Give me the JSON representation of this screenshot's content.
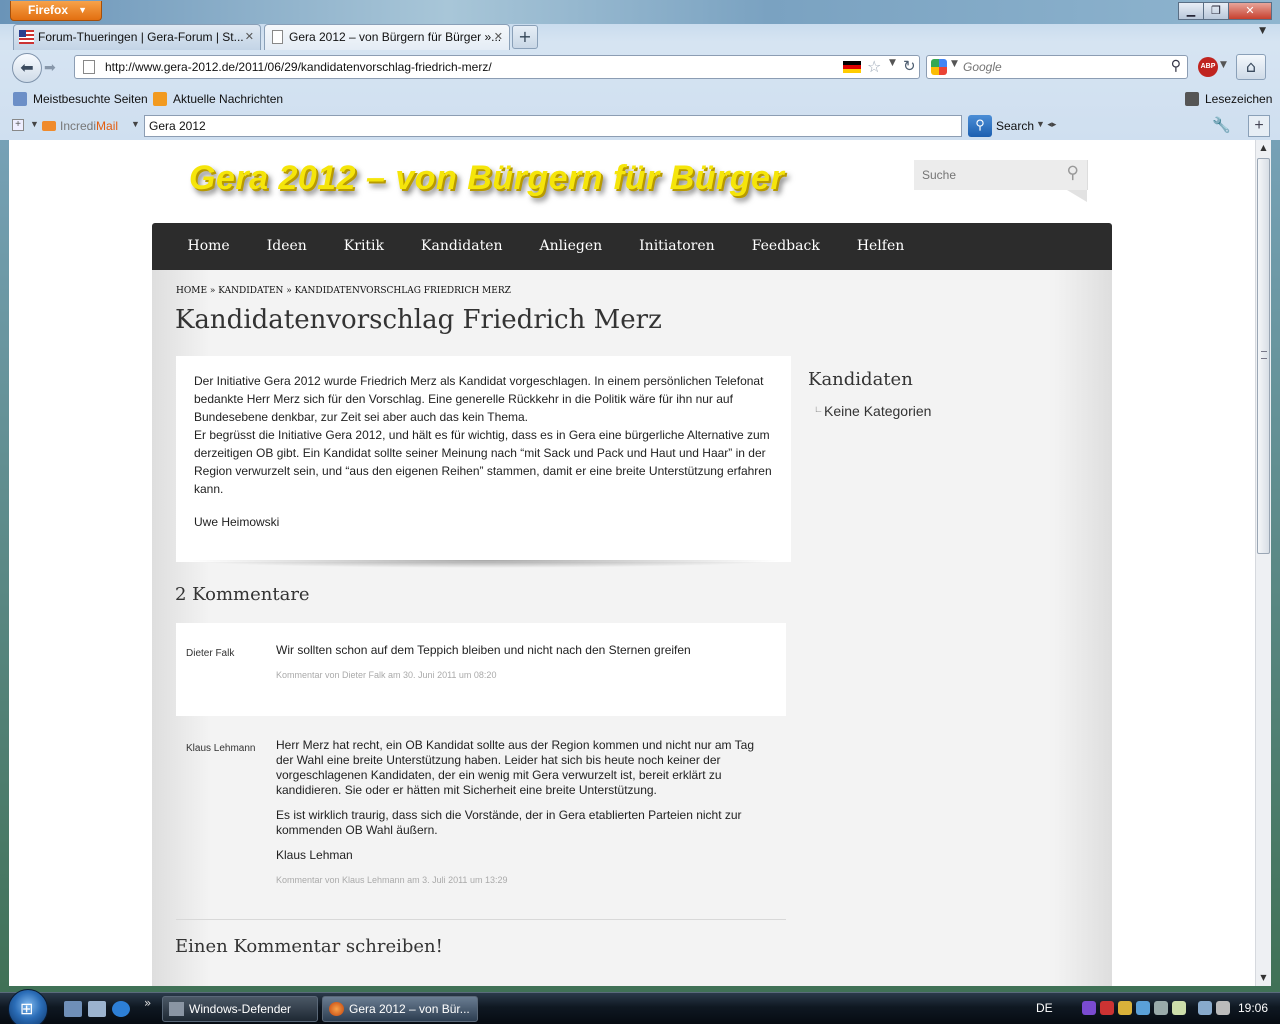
{
  "browser": {
    "app_button": "Firefox",
    "tabs": [
      {
        "label": "Forum-Thueringen | Gera-Forum | St...",
        "active": false
      },
      {
        "label": "Gera 2012 – von Bürgern für Bürger »...",
        "active": true
      }
    ],
    "url": "http://www.gera-2012.de/2011/06/29/kandidatenvorschlag-friedrich-merz/",
    "search_placeholder": "Google",
    "bookmarks": [
      {
        "label": "Meistbesuchte Seiten"
      },
      {
        "label": "Aktuelle Nachrichten"
      }
    ],
    "bookmarks_menu": "Lesezeichen",
    "incredibar": {
      "logo_prefix": "Incredi",
      "logo_suffix": "Mail",
      "query": "Gera 2012",
      "search_label": "Search"
    }
  },
  "site": {
    "title": "Gera 2012 – von Bürgern für Bürger",
    "search_placeholder": "Suche",
    "nav": [
      "Home",
      "Ideen",
      "Kritik",
      "Kandidaten",
      "Anliegen",
      "Initiatoren",
      "Feedback",
      "Helfen"
    ],
    "breadcrumb": "HOME » KANDIDATEN » KANDIDATENVORSCHLAG FRIEDRICH MERZ",
    "page_title": "Kandidatenvorschlag Friedrich Merz",
    "post": {
      "para1": "Der Initiative Gera 2012 wurde Friedrich Merz als Kandidat vorgeschlagen. In einem persönlichen Telefonat bedankte Herr Merz sich für den Vorschlag. Eine generelle Rückkehr in die Politik wäre für ihn nur auf Bundesebene denkbar, zur Zeit sei aber auch das kein Thema.",
      "para2": "Er begrüsst die Initiative Gera 2012, und hält es für wichtig, dass es in Gera eine bürgerliche Alternative zum derzeitigen OB gibt. Ein Kandidat sollte seiner Meinung nach “mit Sack und Pack und Haut und Haar” in der Region verwurzelt sein, und “aus den eigenen Reihen” stammen, damit er eine breite Unterstützung erfahren kann.",
      "author": "Uwe Heimowski"
    },
    "sidebar": {
      "title": "Kandidaten",
      "items": [
        "Keine Kategorien"
      ]
    },
    "comments_title": "2 Kommentare",
    "comments": [
      {
        "author": "Dieter Falk",
        "paragraphs": [
          "Wir sollten schon auf dem Teppich bleiben und nicht nach den Sternen greifen"
        ],
        "meta": "Kommentar von Dieter Falk am 30. Juni 2011 um 08:20"
      },
      {
        "author": "Klaus Lehmann",
        "paragraphs": [
          "Herr Merz hat recht, ein OB Kandidat sollte aus der Region kommen und nicht nur am Tag der Wahl eine breite Unterstützung haben. Leider hat sich bis heute noch keiner der vorgeschlagenen Kandidaten, der ein wenig mit Gera verwurzelt ist, bereit erklärt zu kandidieren. Sie oder er hätten mit Sicherheit eine breite Unterstützung.",
          "Es ist wirklich traurig, dass sich die Vorstände, der in Gera etablierten Parteien nicht zur kommenden OB Wahl äußern.",
          "Klaus Lehman"
        ],
        "meta": "Kommentar von Klaus Lehmann am 3. Juli 2011 um 13:29"
      }
    ],
    "write_comment_title": "Einen Kommentar schreiben!"
  },
  "taskbar": {
    "tasks": [
      {
        "label": "Windows-Defender",
        "active": false
      },
      {
        "label": "Gera 2012 – von Bür...",
        "active": true
      }
    ],
    "language": "DE",
    "clock": "19:06"
  },
  "colors": {
    "site_title": "#f5e50a",
    "nav_bg": "#2c2c2c",
    "firefox_button": "#e26f10"
  }
}
